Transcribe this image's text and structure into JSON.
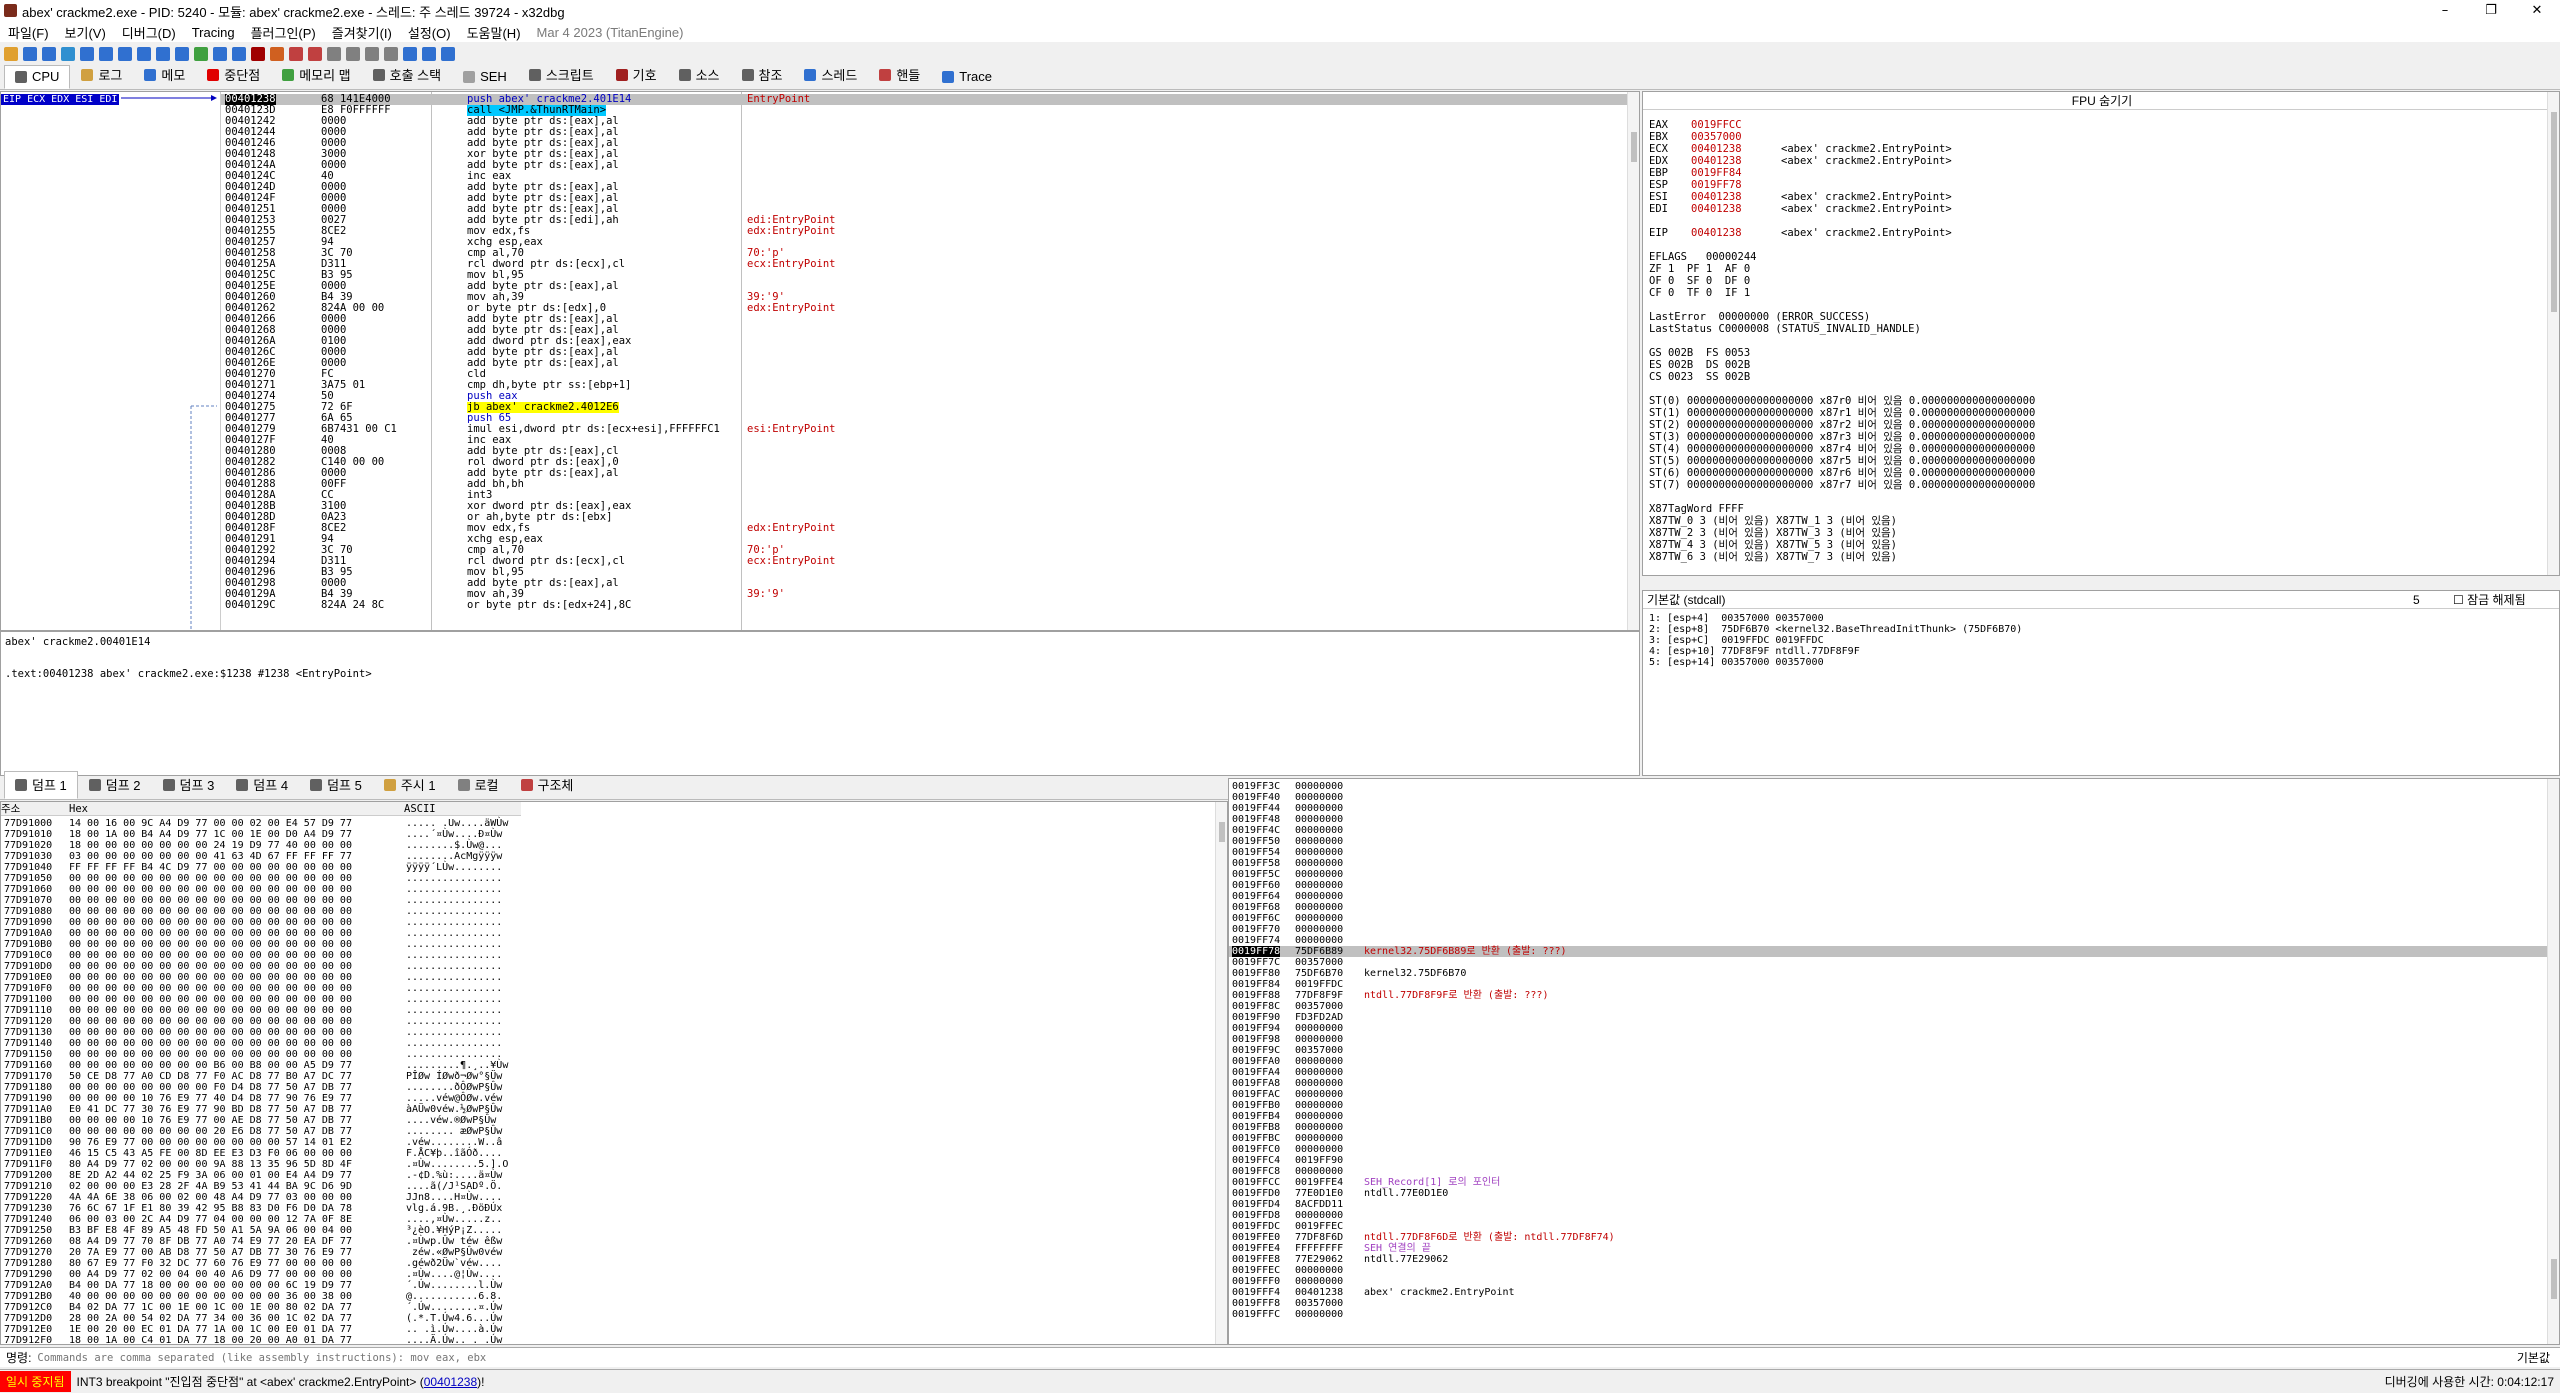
{
  "title": "abex' crackme2.exe - PID: 5240 - 모듈: abex' crackme2.exe - 스레드: 주 스레드 39724 - x32dbg",
  "menu": [
    "파일(F)",
    "보기(V)",
    "디버그(D)",
    "Tracing",
    "플러그인(P)",
    "즐겨찾기(I)",
    "설정(O)",
    "도움말(H)",
    "Mar 4 2023 (TitanEngine)"
  ],
  "tabs": [
    "CPU",
    "로그",
    "메모",
    "중단점",
    "메모리 맵",
    "호출 스택",
    "SEH",
    "스크립트",
    "기호",
    "소스",
    "참조",
    "스레드",
    "핸들",
    "Trace"
  ],
  "eip_label": "EIP ECX EDX ESI EDI",
  "disasm": [
    [
      "00401238",
      "68 141E4000",
      "push abex' crackme2.401E14",
      "EntryPoint"
    ],
    [
      "0040123D",
      "E8 F0FFFFFF",
      "call <JMP.&ThunRTMain>",
      ""
    ],
    [
      "00401242",
      "0000",
      "add byte ptr ds:[eax],al",
      ""
    ],
    [
      "00401244",
      "0000",
      "add byte ptr ds:[eax],al",
      ""
    ],
    [
      "00401246",
      "0000",
      "add byte ptr ds:[eax],al",
      ""
    ],
    [
      "00401248",
      "3000",
      "xor byte ptr ds:[eax],al",
      ""
    ],
    [
      "0040124A",
      "0000",
      "add byte ptr ds:[eax],al",
      ""
    ],
    [
      "0040124C",
      "40",
      "inc eax",
      ""
    ],
    [
      "0040124D",
      "0000",
      "add byte ptr ds:[eax],al",
      ""
    ],
    [
      "0040124F",
      "0000",
      "add byte ptr ds:[eax],al",
      ""
    ],
    [
      "00401251",
      "0000",
      "add byte ptr ds:[eax],al",
      ""
    ],
    [
      "00401253",
      "0027",
      "add byte ptr ds:[edi],ah",
      "edi:EntryPoint"
    ],
    [
      "00401255",
      "8CE2",
      "mov edx,fs",
      "edx:EntryPoint"
    ],
    [
      "00401257",
      "94",
      "xchg esp,eax",
      ""
    ],
    [
      "00401258",
      "3C 70",
      "cmp al,70",
      "70:'p'"
    ],
    [
      "0040125A",
      "D311",
      "rcl dword ptr ds:[ecx],cl",
      "ecx:EntryPoint"
    ],
    [
      "0040125C",
      "B3 95",
      "mov bl,95",
      ""
    ],
    [
      "0040125E",
      "0000",
      "add byte ptr ds:[eax],al",
      ""
    ],
    [
      "00401260",
      "B4 39",
      "mov ah,39",
      "39:'9'"
    ],
    [
      "00401262",
      "824A 00 00",
      "or byte ptr ds:[edx],0",
      "edx:EntryPoint"
    ],
    [
      "00401266",
      "0000",
      "add byte ptr ds:[eax],al",
      ""
    ],
    [
      "00401268",
      "0000",
      "add byte ptr ds:[eax],al",
      ""
    ],
    [
      "0040126A",
      "0100",
      "add dword ptr ds:[eax],eax",
      ""
    ],
    [
      "0040126C",
      "0000",
      "add byte ptr ds:[eax],al",
      ""
    ],
    [
      "0040126E",
      "0000",
      "add byte ptr ds:[eax],al",
      ""
    ],
    [
      "00401270",
      "FC",
      "cld",
      ""
    ],
    [
      "00401271",
      "3A75 01",
      "cmp dh,byte ptr ss:[ebp+1]",
      ""
    ],
    [
      "00401274",
      "50",
      "push eax",
      ""
    ],
    [
      "00401275",
      "72 6F",
      "jb abex' crackme2.4012E6",
      ""
    ],
    [
      "00401277",
      "6A 65",
      "push 65",
      ""
    ],
    [
      "00401279",
      "6B7431 00 C1",
      "imul esi,dword ptr ds:[ecx+esi],FFFFFFC1",
      "esi:EntryPoint"
    ],
    [
      "0040127F",
      "40",
      "inc eax",
      ""
    ],
    [
      "00401280",
      "0008",
      "add byte ptr ds:[eax],cl",
      ""
    ],
    [
      "00401282",
      "C140 00 00",
      "rol dword ptr ds:[eax],0",
      ""
    ],
    [
      "00401286",
      "0000",
      "add byte ptr ds:[eax],al",
      ""
    ],
    [
      "00401288",
      "00FF",
      "add bh,bh",
      ""
    ],
    [
      "0040128A",
      "CC",
      "int3",
      ""
    ],
    [
      "0040128B",
      "3100",
      "xor dword ptr ds:[eax],eax",
      ""
    ],
    [
      "0040128D",
      "0A23",
      "or ah,byte ptr ds:[ebx]",
      ""
    ],
    [
      "0040128F",
      "8CE2",
      "mov edx,fs",
      "edx:EntryPoint"
    ],
    [
      "00401291",
      "94",
      "xchg esp,eax",
      ""
    ],
    [
      "00401292",
      "3C 70",
      "cmp al,70",
      "70:'p'"
    ],
    [
      "00401294",
      "D311",
      "rcl dword ptr ds:[ecx],cl",
      "ecx:EntryPoint"
    ],
    [
      "00401296",
      "B3 95",
      "mov bl,95",
      ""
    ],
    [
      "00401298",
      "0000",
      "add byte ptr ds:[eax],al",
      ""
    ],
    [
      "0040129A",
      "B4 39",
      "mov ah,39",
      "39:'9'"
    ],
    [
      "0040129C",
      "824A 24 8C",
      "or byte ptr ds:[edx+24],8C",
      ""
    ]
  ],
  "info_lines": [
    "abex' crackme2.00401E14",
    ".text:00401238 abex' crackme2.exe:$1238 #1238 <EntryPoint>"
  ],
  "fpu_header": "FPU 숨기기",
  "registers": [
    [
      "EAX",
      "0019FFCC",
      ""
    ],
    [
      "EBX",
      "00357000",
      ""
    ],
    [
      "ECX",
      "00401238",
      "<abex' crackme2.EntryPoint>"
    ],
    [
      "EDX",
      "00401238",
      "<abex' crackme2.EntryPoint>"
    ],
    [
      "EBP",
      "0019FF84",
      ""
    ],
    [
      "ESP",
      "0019FF78",
      ""
    ],
    [
      "ESI",
      "00401238",
      "<abex' crackme2.EntryPoint>"
    ],
    [
      "EDI",
      "00401238",
      "<abex' crackme2.EntryPoint>"
    ],
    [
      "EIP",
      "00401238",
      "<abex' crackme2.EntryPoint>"
    ]
  ],
  "flags": [
    "EFLAGS   00000244",
    "ZF 1  PF 1  AF 0",
    "OF 0  SF 0  DF 0",
    "CF 0  TF 0  IF 1"
  ],
  "errors": [
    "LastError  00000000 (ERROR_SUCCESS)",
    "LastStatus C0000008 (STATUS_INVALID_HANDLE)"
  ],
  "segs": [
    "GS 002B  FS 0053",
    "ES 002B  DS 002B",
    "CS 0023  SS 002B"
  ],
  "st_regs": [
    "ST(0) 00000000000000000000 x87r0 비어 있음 0.000000000000000000",
    "ST(1) 00000000000000000000 x87r1 비어 있음 0.000000000000000000",
    "ST(2) 00000000000000000000 x87r2 비어 있음 0.000000000000000000",
    "ST(3) 00000000000000000000 x87r3 비어 있음 0.000000000000000000",
    "ST(4) 00000000000000000000 x87r4 비어 있음 0.000000000000000000",
    "ST(5) 00000000000000000000 x87r5 비어 있음 0.000000000000000000",
    "ST(6) 00000000000000000000 x87r6 비어 있음 0.000000000000000000",
    "ST(7) 00000000000000000000 x87r7 비어 있음 0.000000000000000000"
  ],
  "tagword": [
    "X87TagWord FFFF",
    "X87TW_0 3 (비어 있음) X87TW_1 3 (비어 있음)",
    "X87TW_2 3 (비어 있음) X87TW_3 3 (비어 있음)",
    "X87TW_4 3 (비어 있음) X87TW_5 3 (비어 있음)",
    "X87TW_6 3 (비어 있음) X87TW_7 3 (비어 있음)"
  ],
  "callconv": {
    "label": "기본값 (stdcall)",
    "count": "5",
    "lock": "잠금 해제됨"
  },
  "call_args": [
    "1: [esp+4]  00357000 00357000",
    "2: [esp+8]  75DF6B70 <kernel32.BaseThreadInitThunk> (75DF6B70)",
    "3: [esp+C]  0019FFDC 0019FFDC",
    "4: [esp+10] 77DF8F9F ntdll.77DF8F9F",
    "5: [esp+14] 00357000 00357000"
  ],
  "dump_tabs": [
    "덤프 1",
    "덤프 2",
    "덤프 3",
    "덤프 4",
    "덤프 5",
    "주시 1",
    "로컬",
    "구조체"
  ],
  "dump_headers": {
    "addr": "주소",
    "hex": "Hex",
    "ascii": "ASCII"
  },
  "dump": [
    [
      "77D91000",
      "14 00 16 00 9C A4 D9 77 00 00 02 00 E4 57 D9 77",
      "..... .Uw....äWÙw"
    ],
    [
      "77D91010",
      "18 00 1A 00 B4 A4 D9 77 1C 00 1E 00 D0 A4 D9 77",
      "....´¤Ùw....Ð¤Ùw"
    ],
    [
      "77D91020",
      "18 00 00 00 00 00 00 00 24 19 D9 77 40 00 00 00",
      "........$.Ùw@..."
    ],
    [
      "77D91030",
      "03 00 00 00 00 00 00 00 41 63 4D 67 FF FF FF 77",
      "........AcMgÿÿÿw"
    ],
    [
      "77D91040",
      "FF FF FF FF B4 4C D9 77 00 00 00 00 00 00 00 00",
      "ÿÿÿÿ´LÙw........"
    ],
    [
      "77D91050",
      "00 00 00 00 00 00 00 00 00 00 00 00 00 00 00 00",
      "................"
    ],
    [
      "77D91060",
      "00 00 00 00 00 00 00 00 00 00 00 00 00 00 00 00",
      "................"
    ],
    [
      "77D91070",
      "00 00 00 00 00 00 00 00 00 00 00 00 00 00 00 00",
      "................"
    ],
    [
      "77D91080",
      "00 00 00 00 00 00 00 00 00 00 00 00 00 00 00 00",
      "................"
    ],
    [
      "77D91090",
      "00 00 00 00 00 00 00 00 00 00 00 00 00 00 00 00",
      "................"
    ],
    [
      "77D910A0",
      "00 00 00 00 00 00 00 00 00 00 00 00 00 00 00 00",
      "................"
    ],
    [
      "77D910B0",
      "00 00 00 00 00 00 00 00 00 00 00 00 00 00 00 00",
      "................"
    ],
    [
      "77D910C0",
      "00 00 00 00 00 00 00 00 00 00 00 00 00 00 00 00",
      "................"
    ],
    [
      "77D910D0",
      "00 00 00 00 00 00 00 00 00 00 00 00 00 00 00 00",
      "................"
    ],
    [
      "77D910E0",
      "00 00 00 00 00 00 00 00 00 00 00 00 00 00 00 00",
      "................"
    ],
    [
      "77D910F0",
      "00 00 00 00 00 00 00 00 00 00 00 00 00 00 00 00",
      "................"
    ],
    [
      "77D91100",
      "00 00 00 00 00 00 00 00 00 00 00 00 00 00 00 00",
      "................"
    ],
    [
      "77D91110",
      "00 00 00 00 00 00 00 00 00 00 00 00 00 00 00 00",
      "................"
    ],
    [
      "77D91120",
      "00 00 00 00 00 00 00 00 00 00 00 00 00 00 00 00",
      "................"
    ],
    [
      "77D91130",
      "00 00 00 00 00 00 00 00 00 00 00 00 00 00 00 00",
      "................"
    ],
    [
      "77D91140",
      "00 00 00 00 00 00 00 00 00 00 00 00 00 00 00 00",
      "................"
    ],
    [
      "77D91150",
      "00 00 00 00 00 00 00 00 00 00 00 00 00 00 00 00",
      "................"
    ],
    [
      "77D91160",
      "00 00 00 00 00 00 00 00 B6 00 B8 00 00 A5 D9 77",
      ".........¶.¸..¥Ùw"
    ],
    [
      "77D91170",
      "50 CE D8 77 A0 CD D8 77 F0 AC D8 77 B0 A7 DC 77",
      "PÎØw ÍØwð¬Øw°§Üw"
    ],
    [
      "77D91180",
      "00 00 00 00 00 00 00 00 F0 D4 D8 77 50 A7 DB 77",
      "........ðÔØwP§Ûw"
    ],
    [
      "77D91190",
      "00 00 00 00 10 76 E9 77 40 D4 D8 77 90 76 E9 77",
      ".....véw@ÔØw.véw"
    ],
    [
      "77D911A0",
      "E0 41 DC 77 30 76 E9 77 90 BD D8 77 50 A7 DB 77",
      "àAÜw0véw.½ØwP§Ûw"
    ],
    [
      "77D911B0",
      "00 00 00 00 10 76 E9 77 00 AE D8 77 50 A7 DB 77",
      "....véw.®ØwP§Ûw"
    ],
    [
      "77D911C0",
      "00 00 00 00 00 00 00 00 20 E6 D8 77 50 A7 DB 77",
      "........ æØwP§Ûw"
    ],
    [
      "77D911D0",
      "90 76 E9 77 00 00 00 00 00 00 00 00 57 14 01 E2",
      ".véw........W..â"
    ],
    [
      "77D911E0",
      "46 15 C5 43 A5 FE 00 8D EE E3 D3 F0 06 00 00 00",
      "F.ÅC¥þ..îãÓð...."
    ],
    [
      "77D911F0",
      "80 A4 D9 77 02 00 00 00 9A 88 13 35 96 5D 8D 4F",
      ".¤Ùw........5.].O"
    ],
    [
      "77D91200",
      "8E 2D A2 44 02 25 F9 3A 06 00 01 00 E4 A4 D9 77",
      ".-¢D.%ù:....ä¤Ùw"
    ],
    [
      "77D91210",
      "02 00 00 00 E3 28 2F 4A B9 53 41 44 BA 9C D6 9D",
      "....ã(/J¹SADº.Ö."
    ],
    [
      "77D91220",
      "4A 4A 6E 38 06 00 02 00 48 A4 D9 77 03 00 00 00",
      "JJn8....H¤Ùw...."
    ],
    [
      "77D91230",
      "76 6C 67 1F E1 80 39 42 95 B8 83 D0 F6 D0 DA 78",
      "vlg.á.9B.¸.ÐöÐÚx"
    ],
    [
      "77D91240",
      "06 00 03 00 2C A4 D9 77 04 00 00 00 12 7A 0F 8E",
      "....,¤Ùw.....z.."
    ],
    [
      "77D91250",
      "B3 BF E8 4F 89 A5 48 FD 50 A1 5A 9A 06 00 04 00",
      "³¿èO.¥HýP¡Z....."
    ],
    [
      "77D91260",
      "08 A4 D9 77 70 8F DB 77 A0 74 E9 77 20 EA DF 77",
      ".¤Ùwp.Ûw téw êßw"
    ],
    [
      "77D91270",
      "20 7A E9 77 00 AB D8 77 50 A7 DB 77 30 76 E9 77",
      " zéw.«ØwP§Ûw0véw"
    ],
    [
      "77D91280",
      "80 67 E9 77 F0 32 DC 77 60 76 E9 77 00 00 00 00",
      ".géwð2Üw`véw...."
    ],
    [
      "77D91290",
      "00 A4 D9 77 02 00 04 00 40 A6 D9 77 00 00 00 00",
      ".¤Ùw....@¦Ùw...."
    ],
    [
      "77D912A0",
      "B4 00 DA 77 18 00 00 00 00 00 00 00 6C 19 D9 77",
      "´.Úw........l.Ùw"
    ],
    [
      "77D912B0",
      "40 00 00 00 00 00 00 00 00 00 00 00 36 00 38 00",
      "@...........6.8."
    ],
    [
      "77D912C0",
      "B4 02 DA 77 1C 00 1E 00 1C 00 1E 00 80 02 DA 77",
      "´.Úw........¤.Úw"
    ],
    [
      "77D912D0",
      "28 00 2A 00 54 02 DA 77 34 00 36 00 1C 02 DA 77",
      "(.*.T.Úw4.6...Úw"
    ],
    [
      "77D912E0",
      "1E 00 20 00 EC 01 DA 77 1A 00 1C 00 E0 01 DA 77",
      ".. .ì.Úw....à.Úw"
    ],
    [
      "77D912F0",
      "18 00 1A 00 C4 01 DA 77 18 00 20 00 A0 01 DA 77",
      "....Ä.Úw.. . .Úw"
    ]
  ],
  "stack": [
    [
      "0019FF3C",
      "00000000",
      ""
    ],
    [
      "0019FF40",
      "00000000",
      ""
    ],
    [
      "0019FF44",
      "00000000",
      ""
    ],
    [
      "0019FF48",
      "00000000",
      ""
    ],
    [
      "0019FF4C",
      "00000000",
      ""
    ],
    [
      "0019FF50",
      "00000000",
      ""
    ],
    [
      "0019FF54",
      "00000000",
      ""
    ],
    [
      "0019FF58",
      "00000000",
      ""
    ],
    [
      "0019FF5C",
      "00000000",
      ""
    ],
    [
      "0019FF60",
      "00000000",
      ""
    ],
    [
      "0019FF64",
      "00000000",
      ""
    ],
    [
      "0019FF68",
      "00000000",
      ""
    ],
    [
      "0019FF6C",
      "00000000",
      ""
    ],
    [
      "0019FF70",
      "00000000",
      ""
    ],
    [
      "0019FF74",
      "00000000",
      ""
    ],
    [
      "0019FF78",
      "75DF6B89",
      "kernel32.75DF6B89로 반환 (출발: ???)"
    ],
    [
      "0019FF7C",
      "00357000",
      ""
    ],
    [
      "0019FF80",
      "75DF6B70",
      "kernel32.75DF6B70"
    ],
    [
      "0019FF84",
      "0019FFDC",
      ""
    ],
    [
      "0019FF88",
      "77DF8F9F",
      "ntdll.77DF8F9F로 반환 (출발: ???)"
    ],
    [
      "0019FF8C",
      "00357000",
      ""
    ],
    [
      "0019FF90",
      "FD3FD2AD",
      ""
    ],
    [
      "0019FF94",
      "00000000",
      ""
    ],
    [
      "0019FF98",
      "00000000",
      ""
    ],
    [
      "0019FF9C",
      "00357000",
      ""
    ],
    [
      "0019FFA0",
      "00000000",
      ""
    ],
    [
      "0019FFA4",
      "00000000",
      ""
    ],
    [
      "0019FFA8",
      "00000000",
      ""
    ],
    [
      "0019FFAC",
      "00000000",
      ""
    ],
    [
      "0019FFB0",
      "00000000",
      ""
    ],
    [
      "0019FFB4",
      "00000000",
      ""
    ],
    [
      "0019FFB8",
      "00000000",
      ""
    ],
    [
      "0019FFBC",
      "00000000",
      ""
    ],
    [
      "0019FFC0",
      "00000000",
      ""
    ],
    [
      "0019FFC4",
      "0019FF90",
      ""
    ],
    [
      "0019FFC8",
      "00000000",
      ""
    ],
    [
      "0019FFCC",
      "0019FFE4",
      "SEH_Record[1] 로의 포인터"
    ],
    [
      "0019FFD0",
      "77E0D1E0",
      "ntdll.77E0D1E0"
    ],
    [
      "0019FFD4",
      "8ACFDD11",
      ""
    ],
    [
      "0019FFD8",
      "00000000",
      ""
    ],
    [
      "0019FFDC",
      "0019FFEC",
      ""
    ],
    [
      "0019FFE0",
      "77DF8F6D",
      "ntdll.77DF8F6D로 반환 (출발: ntdll.77DF8F74)"
    ],
    [
      "0019FFE4",
      "FFFFFFFF",
      "SEH 연결의 끝"
    ],
    [
      "0019FFE8",
      "77E29062",
      "ntdll.77E29062"
    ],
    [
      "0019FFEC",
      "00000000",
      ""
    ],
    [
      "0019FFF0",
      "00000000",
      ""
    ],
    [
      "0019FFF4",
      "00401238",
      "abex' crackme2.EntryPoint"
    ],
    [
      "0019FFF8",
      "00357000",
      ""
    ],
    [
      "0019FFFC",
      "00000000",
      ""
    ]
  ],
  "command": {
    "label": "명령:",
    "placeholder": "Commands are comma separated (like assembly instructions): mov eax, ebx",
    "default": "기본값"
  },
  "status": {
    "state": "일시 중지됨",
    "msg": "INT3 breakpoint \"진입점 중단점\" at <abex' crackme2.EntryPoint> (",
    "addr": "00401238",
    "tail": ")!",
    "right": "디버깅에 사용한 시간: 0:04:12:17"
  }
}
